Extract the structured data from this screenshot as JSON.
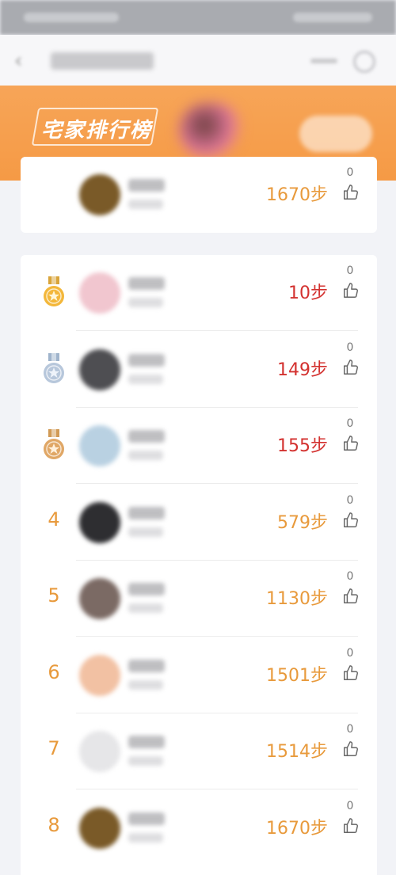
{
  "banner": {
    "title": "宅家排行榜"
  },
  "colors": {
    "accent": "#f59a45",
    "top_steps": "#d3312f",
    "steps": "#e89a3c"
  },
  "my_entry": {
    "steps": "1670步",
    "likes": "0",
    "avatar_color": "#7a5a28"
  },
  "ranking": [
    {
      "rank": "1",
      "medal": "gold",
      "steps": "10步",
      "likes": "0",
      "avatar_color": "#f1c6cf"
    },
    {
      "rank": "2",
      "medal": "silver",
      "steps": "149步",
      "likes": "0",
      "avatar_color": "#4e4e52"
    },
    {
      "rank": "3",
      "medal": "bronze",
      "steps": "155步",
      "likes": "0",
      "avatar_color": "#b9d1e2"
    },
    {
      "rank": "4",
      "medal": "",
      "steps": "579步",
      "likes": "0",
      "avatar_color": "#2e2e31"
    },
    {
      "rank": "5",
      "medal": "",
      "steps": "1130步",
      "likes": "0",
      "avatar_color": "#7b6a64"
    },
    {
      "rank": "6",
      "medal": "",
      "steps": "1501步",
      "likes": "0",
      "avatar_color": "#f2c1a3"
    },
    {
      "rank": "7",
      "medal": "",
      "steps": "1514步",
      "likes": "0",
      "avatar_color": "#e6e6e8"
    },
    {
      "rank": "8",
      "medal": "",
      "steps": "1670步",
      "likes": "0",
      "avatar_color": "#7a5a28"
    }
  ]
}
